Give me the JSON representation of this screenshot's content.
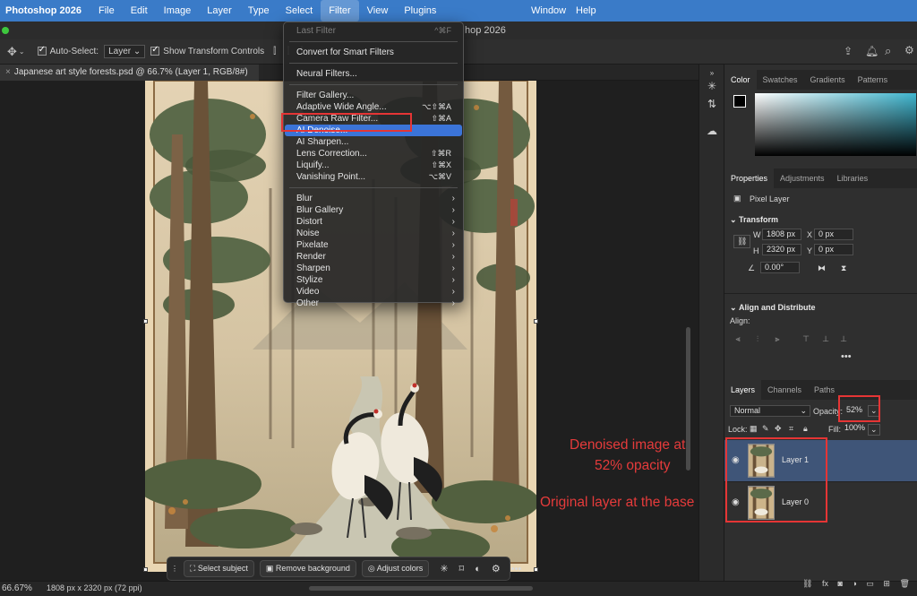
{
  "menubar": {
    "app_name": "Photoshop 2026",
    "items": [
      "File",
      "Edit",
      "Image",
      "Layer",
      "Type",
      "Select",
      "Filter",
      "View",
      "Plugins"
    ],
    "right_items": [
      "Window",
      "Help"
    ]
  },
  "window": {
    "title_fragment": "hop 2026"
  },
  "options_bar": {
    "auto_select_label": "Auto-Select:",
    "auto_select_value": "Layer",
    "show_transform_label": "Show Transform Controls"
  },
  "document": {
    "tab_title": "Japanese art style forests.psd @ 66.7% (Layer 1, RGB/8#)",
    "close_glyph": "×"
  },
  "filter_menu": {
    "last_filter": {
      "label": "Last Filter",
      "shortcut": "^⌘F"
    },
    "convert_smart": "Convert for Smart Filters",
    "neural": "Neural Filters...",
    "group1": [
      {
        "label": "Filter Gallery...",
        "shortcut": ""
      },
      {
        "label": "Adaptive Wide Angle...",
        "shortcut": "⌥⇧⌘A"
      },
      {
        "label": "Camera Raw Filter...",
        "shortcut": "⇧⌘A"
      },
      {
        "label": "AI Denoise...",
        "shortcut": ""
      },
      {
        "label": "AI Sharpen...",
        "shortcut": ""
      },
      {
        "label": "Lens Correction...",
        "shortcut": "⇧⌘R"
      },
      {
        "label": "Liquify...",
        "shortcut": "⇧⌘X"
      },
      {
        "label": "Vanishing Point...",
        "shortcut": "⌥⌘V"
      }
    ],
    "submenus": [
      "Blur",
      "Blur Gallery",
      "Distort",
      "Noise",
      "Pixelate",
      "Render",
      "Sharpen",
      "Stylize",
      "Video",
      "Other"
    ]
  },
  "color_panel": {
    "tabs": [
      "Color",
      "Swatches",
      "Gradients",
      "Patterns"
    ]
  },
  "properties_panel": {
    "tabs": [
      "Properties",
      "Adjustments",
      "Libraries"
    ],
    "layer_type": "Pixel Layer",
    "transform_title": "Transform",
    "w_label": "W",
    "w_value": "1808 px",
    "h_label": "H",
    "h_value": "2320 px",
    "x_label": "X",
    "x_value": "0 px",
    "y_label": "Y",
    "y_value": "0 px",
    "angle_value": "0.00°",
    "align_title": "Align and Distribute",
    "align_label": "Align:"
  },
  "layers_panel": {
    "tabs": [
      "Layers",
      "Channels",
      "Paths"
    ],
    "blend_mode": "Normal",
    "opacity_label": "Opacity:",
    "opacity_value": "52%",
    "opacity_fraction": 0.52,
    "lock_label": "Lock:",
    "fill_label": "Fill:",
    "fill_value": "100%",
    "layers": [
      {
        "name": "Layer 1",
        "selected": true
      },
      {
        "name": "Layer 0",
        "selected": false
      }
    ]
  },
  "annotations": {
    "top_line1": "Denoised image at",
    "top_line2": "52% opacity",
    "bottom": "Original layer at the base"
  },
  "taskbar": {
    "select_subject": "Select subject",
    "remove_background": "Remove background",
    "adjust_colors": "Adjust colors"
  },
  "status": {
    "zoom": "66.67%",
    "dimensions": "1808 px x 2320 px (72 ppi)"
  },
  "colors": {
    "menubar": "#3a7bc8",
    "highlight": "#3b74d8",
    "annotation_red": "#e53535",
    "selected_layer": "#3f5578"
  }
}
